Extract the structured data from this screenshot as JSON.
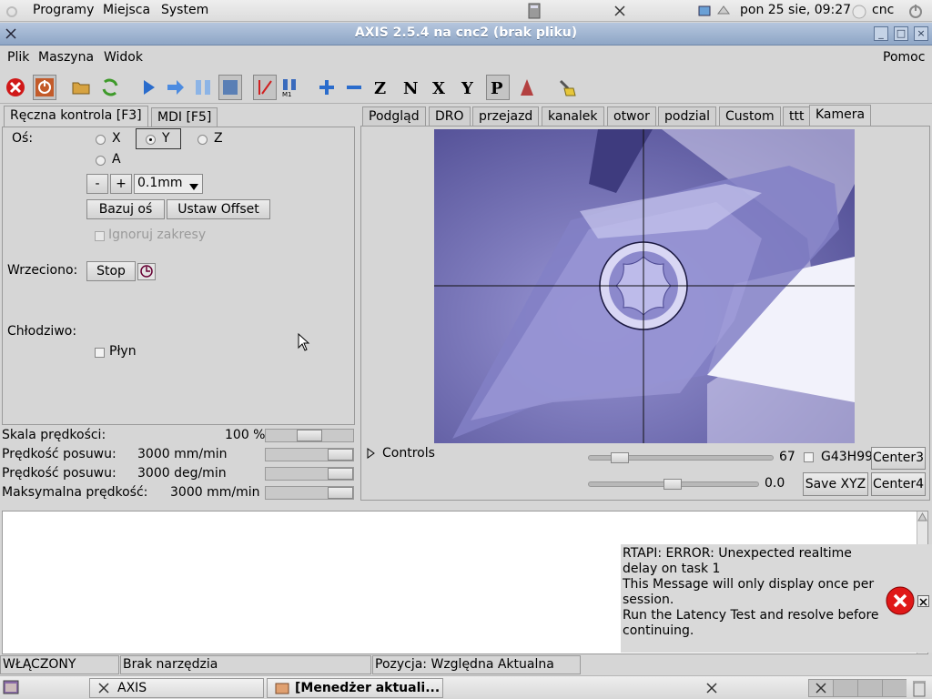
{
  "top_panel": {
    "menus": [
      "Programy",
      "Miejsca",
      "System"
    ],
    "clock": "pon 25 sie, 09:27",
    "user": "cnc"
  },
  "window": {
    "title": "AXIS 2.5.4 na cnc2 (brak pliku)"
  },
  "menubar": {
    "items": [
      "Plik",
      "Maszyna",
      "Widok"
    ],
    "help": "Pomoc"
  },
  "left": {
    "tabs": [
      "Ręczna kontrola [F3]",
      "MDI [F5]"
    ],
    "axis_label": "Oś:",
    "axes": [
      "X",
      "Y",
      "Z",
      "A"
    ],
    "selected_axis": "Y",
    "jog_minus": "-",
    "jog_plus": "+",
    "increment": "0.1mm",
    "home_button": "Bazuj oś",
    "offset_button": "Ustaw Offset",
    "ignore_limits": "Ignoruj zakresy",
    "spindle_label": "Wrzeciono:",
    "spindle_stop": "Stop",
    "coolant_label": "Chłodziwo:",
    "flood": "Płyn"
  },
  "overrides": [
    {
      "label": "Skala prędkości:",
      "value": "100 %",
      "level": 0.5
    },
    {
      "label": "Prędkość posuwu:",
      "value": "3000 mm/min",
      "level": 1.0
    },
    {
      "label": "Prędkość posuwu:",
      "value": "3000 deg/min",
      "level": 1.0
    },
    {
      "label": "Maksymalna prędkość:",
      "value": "3000 mm/min",
      "level": 1.0
    }
  ],
  "right": {
    "tabs": [
      "Podgląd",
      "DRO",
      "przejazd",
      "kanalek",
      "otwor",
      "podzial",
      "Custom",
      "ttt",
      "Kamera"
    ],
    "active_tab": "Kamera",
    "controls_label": "Controls",
    "slider1_value": "67",
    "slider2_value": "0.0",
    "g43_label": "G43H99",
    "save_xyz": "Save XYZ",
    "center3": "Center3",
    "center4": "Center4"
  },
  "error_popup": {
    "lines": [
      "RTAPI: ERROR: Unexpected realtime",
      "delay on task 1",
      "This Message will only display once per",
      "session.",
      "Run the Latency Test and resolve before",
      "continuing."
    ]
  },
  "statusbar": {
    "state": "WŁĄCZONY",
    "tool": "Brak narzędzia",
    "position": "Pozycja: Względna Aktualna"
  },
  "taskbar": {
    "tasks": [
      "AXIS",
      "[Menedżer aktuali..."
    ]
  }
}
